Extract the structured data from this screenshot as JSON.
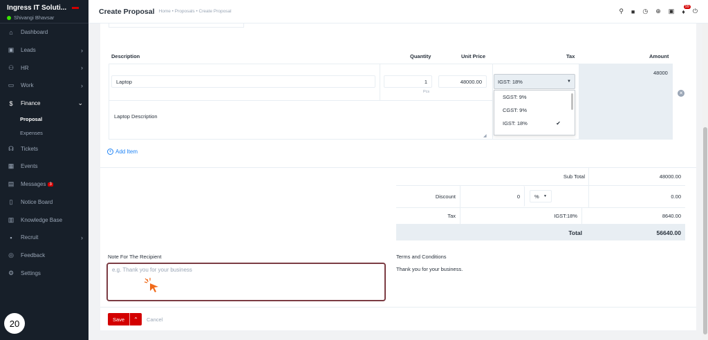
{
  "sidebar": {
    "company": "Ingress IT Soluti...",
    "user": "Shivangi Bhavsar",
    "items": [
      {
        "label": "Dashboard",
        "icon": "house-icon"
      },
      {
        "label": "Leads",
        "icon": "leads-icon"
      },
      {
        "label": "HR",
        "icon": "people-icon"
      },
      {
        "label": "Work",
        "icon": "briefcase-icon"
      },
      {
        "label": "Finance",
        "icon": "dollar-icon"
      },
      {
        "label": "Proposal"
      },
      {
        "label": "Expenses"
      },
      {
        "label": "Tickets",
        "icon": "headset-icon"
      },
      {
        "label": "Events",
        "icon": "calendar-icon"
      },
      {
        "label": "Messages",
        "badge": "3",
        "icon": "message-icon"
      },
      {
        "label": "Notice Board",
        "icon": "clipboard-icon"
      },
      {
        "label": "Knowledge Base",
        "icon": "book-icon"
      },
      {
        "label": "Recruit",
        "icon": "id-card-icon"
      },
      {
        "label": "Feedback",
        "icon": "feedback-icon"
      },
      {
        "label": "Settings",
        "icon": "gear-icon"
      }
    ]
  },
  "step_number": "20",
  "header": {
    "title": "Create Proposal",
    "breadcrumb": "Home • Proposals • Create Proposal",
    "notification_count": "99"
  },
  "items_table": {
    "columns": {
      "description": "Description",
      "quantity": "Quantity",
      "unit_price": "Unit Price",
      "tax": "Tax",
      "amount": "Amount"
    },
    "row": {
      "item_name": "Laptop",
      "quantity": "1",
      "unit": "Pcs",
      "unit_price": "48000.00",
      "tax_selected": "IGST: 18%",
      "tax_options": [
        "SGST: 9%",
        "CGST: 9%",
        "IGST: 18%"
      ],
      "amount": "48000",
      "description": "Laptop Description"
    },
    "add_item": "Add Item"
  },
  "totals": {
    "sub_total_label": "Sub Total",
    "sub_total": "48000.00",
    "discount_label": "Discount",
    "discount_value": "0",
    "discount_type": "%",
    "discount_amount": "0.00",
    "tax_label": "Tax",
    "tax_name": "IGST:18%",
    "tax_amount": "8640.00",
    "total_label": "Total",
    "total": "56640.00"
  },
  "note": {
    "label": "Note For The Recipient",
    "placeholder": "e.g. Thank you for your business"
  },
  "terms": {
    "label": "Terms and Conditions",
    "text": "Thank you for your business."
  },
  "actions": {
    "save": "Save",
    "cancel": "Cancel"
  }
}
